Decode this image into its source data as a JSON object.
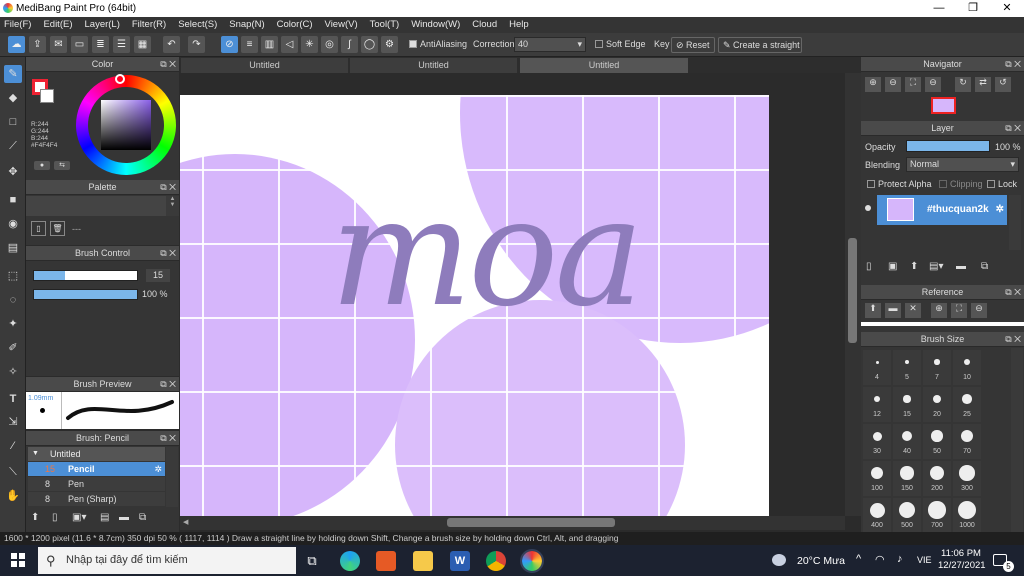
{
  "app": {
    "title": "MediBang Paint Pro (64bit)"
  },
  "menu": [
    "File(F)",
    "Edit(E)",
    "Layer(L)",
    "Filter(R)",
    "Select(S)",
    "Snap(N)",
    "Color(C)",
    "View(V)",
    "Tool(T)",
    "Window(W)",
    "Cloud",
    "Help"
  ],
  "toolbar": {
    "antialiasing": "AntiAliasing",
    "correction_label": "Correction",
    "correction_value": "40",
    "soft_edge": "Soft Edge",
    "key": "Key",
    "reset": "Reset",
    "straight": "Create a straight"
  },
  "tabs": [
    "Untitled",
    "Untitled",
    "Untitled"
  ],
  "color": {
    "title": "Color",
    "r": "R:244",
    "g": "G:244",
    "b": "B:244",
    "hex": "#F4F4F4"
  },
  "palette": {
    "title": "Palette",
    "value": "---"
  },
  "brush_control": {
    "title": "Brush Control",
    "size": "15",
    "opacity": "100 %"
  },
  "brush_preview": {
    "title": "Brush Preview",
    "size": "1.09mm"
  },
  "brush_list": {
    "title": "Brush: Pencil",
    "group": "Untitled",
    "items": [
      {
        "size": "15",
        "name": "Pencil"
      },
      {
        "size": "8",
        "name": "Pen"
      },
      {
        "size": "8",
        "name": "Pen (Sharp)"
      }
    ]
  },
  "navigator": {
    "title": "Navigator"
  },
  "layer": {
    "title": "Layer",
    "opacity_label": "Opacity",
    "opacity_value": "100 %",
    "opacity_level": 1.0,
    "blending_label": "Blending",
    "blending_value": "Normal",
    "protect_alpha": "Protect Alpha",
    "clipping": "Clipping",
    "lock": "Lock",
    "layer_name": "#thucquan2k"
  },
  "reference": {
    "title": "Reference"
  },
  "brush_size": {
    "title": "Brush Size",
    "sizes": [
      "4",
      "5",
      "7",
      "10",
      "12",
      "15",
      "20",
      "25",
      "30",
      "40",
      "50",
      "70",
      "100",
      "150",
      "200",
      "300",
      "400",
      "500",
      "700",
      "1000"
    ]
  },
  "canvas": {
    "text": "moa",
    "bg": "#ffffff",
    "purple": "#d7b8fb",
    "text_color": "#8e7cbc"
  },
  "status": {
    "text": "1600 * 1200 pixel  (11.6 * 8.7cm)  350 dpi  50 %  ( 1117, 1114 )  Draw a straight line by holding down Shift, Change a brush size by holding down Ctrl, Alt, and dragging"
  },
  "taskbar": {
    "search": "Nhập tại đây để tìm kiếm",
    "weather": "20°C  Mưa",
    "lang": "VIE",
    "time": "11:06 PM",
    "date": "12/27/2021",
    "notif": "5"
  },
  "colors": {
    "accent": "#4c8fd6",
    "panel": "#353535"
  }
}
